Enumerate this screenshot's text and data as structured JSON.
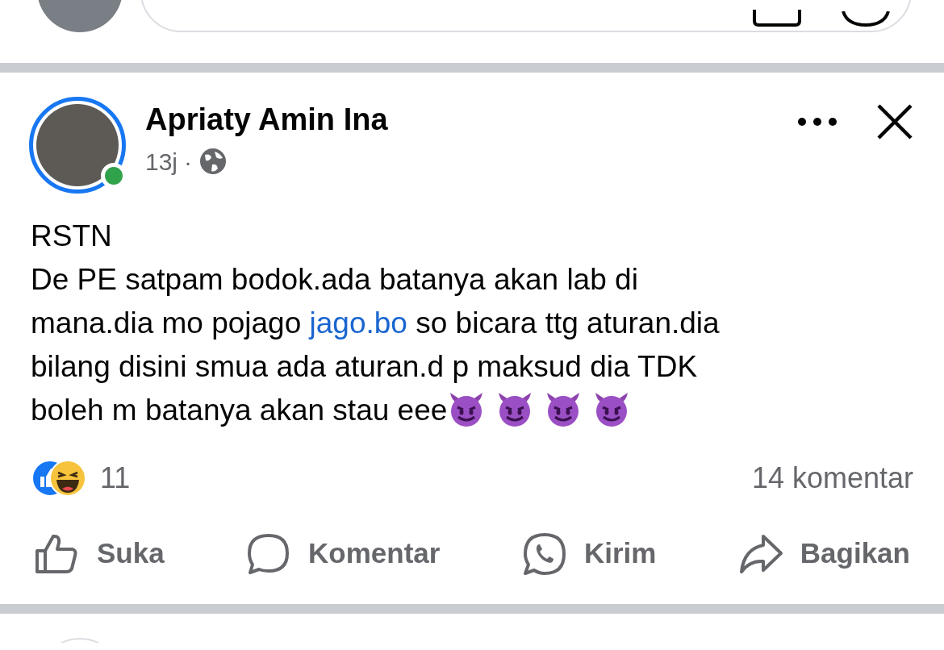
{
  "composer": {
    "has_photo_button": true
  },
  "post": {
    "author": "Apriaty Amin Ina",
    "has_story": true,
    "online": true,
    "time": "13j",
    "separator": "·",
    "body_title": "RSTN",
    "body": [
      [
        {
          "kind": "text",
          "text": "De PE satpam bodok.ada batanya akan lab di"
        }
      ],
      [
        {
          "kind": "text",
          "text": "mana.dia mo pojago "
        },
        {
          "kind": "link",
          "text": "jago.bo"
        },
        {
          "kind": "text",
          "text": " so bicara ttg aturan.dia"
        }
      ],
      [
        {
          "kind": "text",
          "text": "bilang disini smua ada aturan.d p maksud dia TDK"
        }
      ],
      [
        {
          "kind": "text",
          "text": "boleh m batanya akan stau eee"
        }
      ]
    ],
    "trailing_emojis": [
      {
        "kind": "devil"
      },
      {
        "kind": "devil"
      },
      {
        "kind": "devil"
      },
      {
        "kind": "devil"
      }
    ],
    "reactions": [
      {
        "kind": "like"
      },
      {
        "kind": "haha"
      }
    ],
    "reaction_count": "11",
    "comment_count": "14 komentar",
    "actions": [
      {
        "kind": "like",
        "label": "Suka"
      },
      {
        "kind": "comment",
        "label": "Komentar"
      },
      {
        "kind": "whatsapp",
        "label": "Kirim"
      },
      {
        "kind": "share",
        "label": "Bagikan"
      }
    ]
  }
}
